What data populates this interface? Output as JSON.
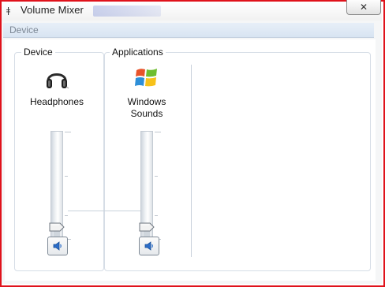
{
  "window": {
    "title": "Volume Mixer",
    "close_glyph": "✕"
  },
  "menu": {
    "items": [
      {
        "label": "Device"
      }
    ]
  },
  "device_section": {
    "label": "Device",
    "device_name": "Headphones",
    "icon": "headphones-icon",
    "volume_percent": 5,
    "mute_icon": "speaker-icon"
  },
  "applications_section": {
    "label": "Applications",
    "apps": [
      {
        "name": "Windows\nSounds",
        "icon": "windows-logo-icon",
        "volume_percent": 5,
        "mute_icon": "speaker-icon"
      }
    ]
  },
  "colors": {
    "frame_red": "#e0121b",
    "menubar": "#dde7f3",
    "slider_thumb": "#f2f2f2",
    "speaker_blue": "#2a6cc8"
  }
}
